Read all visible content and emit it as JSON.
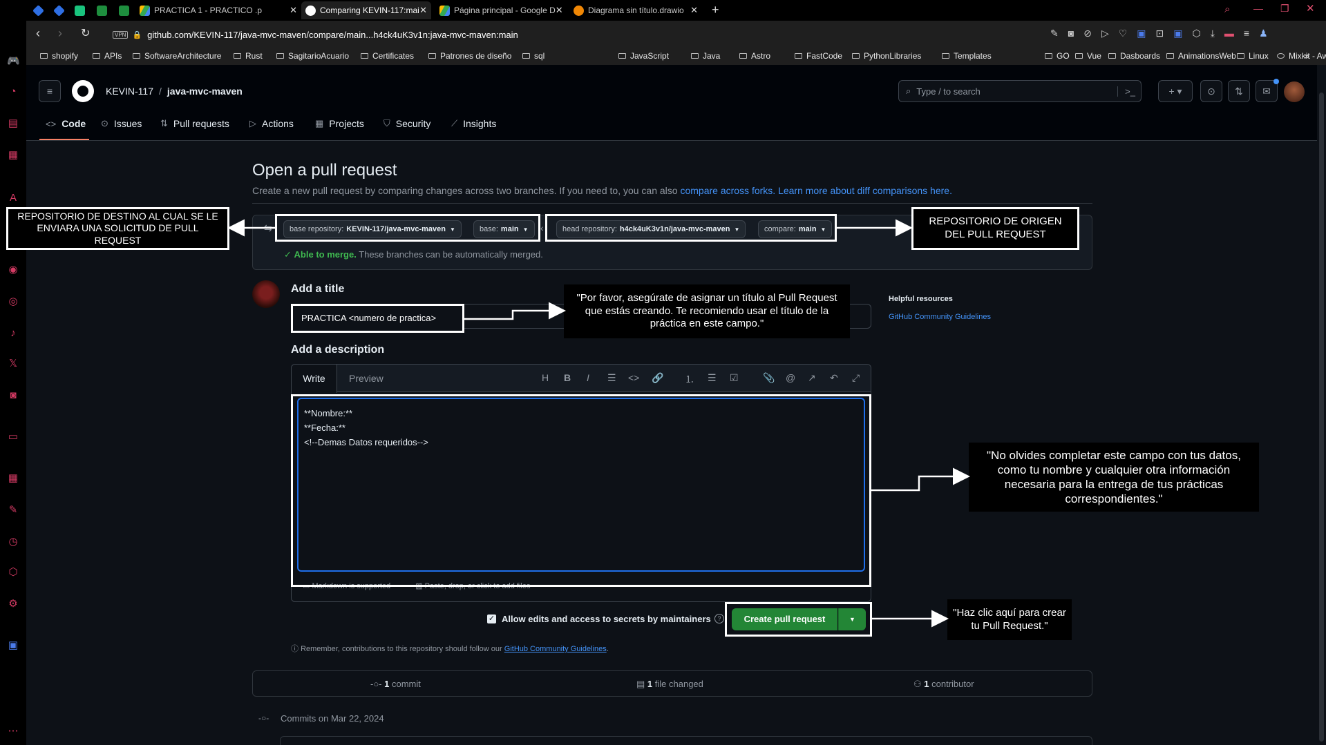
{
  "browser": {
    "tabs": [
      {
        "label": "",
        "icon": "extension-icon"
      },
      {
        "label": "",
        "icon": "extension-icon"
      },
      {
        "label": "",
        "icon": "chatgpt-icon"
      },
      {
        "label": "",
        "icon": "sheets-icon"
      },
      {
        "label": "",
        "icon": "sheets-icon"
      },
      {
        "label": "PRACTICA 1 - PRACTICO .p",
        "icon": "drive-icon"
      },
      {
        "label": "Comparing KEVIN-117:mai",
        "icon": "github-icon"
      },
      {
        "label": "Página principal - Google D",
        "icon": "drive-icon"
      },
      {
        "label": "Diagrama sin título.drawio",
        "icon": "drawio-icon"
      }
    ],
    "vpn_label": "VPN",
    "url": "github.com/KEVIN-117/java-mvc-maven/compare/main...h4ck4uK3v1n:java-mvc-maven:main",
    "bookmarks": [
      "shopify",
      "APIs",
      "SoftwareArchitecture",
      "Rust",
      "SagitarioAcuario",
      "Certificates",
      "Patrones de diseño",
      "sql",
      "JavaScript",
      "Java",
      "Astro",
      "FastCode",
      "PythonLibraries",
      "Templates",
      "GO",
      "Vue",
      "Dasboards",
      "AnimationsWeb",
      "Linux",
      "Mixkit - Awesome f..."
    ]
  },
  "github": {
    "owner": "KEVIN-117",
    "separator": "/",
    "repo": "java-mvc-maven",
    "search_placeholder": "Type / to search",
    "nav": [
      "Code",
      "Issues",
      "Pull requests",
      "Actions",
      "Projects",
      "Security",
      "Insights"
    ],
    "page_title": "Open a pull request",
    "subtitle_text": "Create a new pull request by comparing changes across two branches. If you need to, you can also",
    "subtitle_link1": "compare across forks.",
    "subtitle_link2": "Learn more about diff comparisons here.",
    "base_repo_label": "base repository:",
    "base_repo_value": "KEVIN-117/java-mvc-maven",
    "base_label": "base:",
    "base_value": "main",
    "head_repo_label": "head repository:",
    "head_repo_value": "h4ck4uK3v1n/java-mvc-maven",
    "compare_label": "compare:",
    "compare_value": "main",
    "merge_status": "Able to merge.",
    "merge_detail": "These branches can be automatically merged.",
    "add_title_heading": "Add a title",
    "title_value": "PRACTICA <numero de practica>",
    "add_description_heading": "Add a description",
    "editor_tabs": [
      "Write",
      "Preview"
    ],
    "description_lines": [
      "**Nombre:**",
      "**Fecha:**",
      "<!--Demas Datos requeridos-->"
    ],
    "markdown_note": "Markdown is supported",
    "paste_note": "Paste, drop, or click to add files",
    "allow_edits_label": "Allow edits and access to secrets by maintainers",
    "create_button": "Create pull request",
    "remember_text": "Remember, contributions to this repository should follow our",
    "remember_link": "GitHub Community Guidelines",
    "remember_end": ".",
    "helpful_heading": "Helpful resources",
    "helpful_link": "GitHub Community Guidelines",
    "summary": [
      {
        "count": "1",
        "label": "commit"
      },
      {
        "count": "1",
        "label": "file changed"
      },
      {
        "count": "1",
        "label": "contributor"
      }
    ],
    "commits_heading": "Commits on Mar 22, 2024"
  },
  "annotations": {
    "destino": "REPOSITORIO DE DESTINO AL CUAL SE LE ENVIARA UNA SOLICITUD DE PULL REQUEST",
    "origen": "REPOSITORIO DE ORIGEN DEL PULL REQUEST",
    "titulo": "\"Por favor, asegúrate de asignar un título al Pull Request que estás creando. Te recomiendo usar el título de la práctica en este campo.\"",
    "descripcion": "\"No olvides completar este campo con tus datos, como tu nombre y cualquier otra información necesaria para la entrega de tus prácticas correspondientes.\"",
    "crear": "\"Haz clic aquí para crear tu Pull Request.\""
  },
  "colors": {
    "accent_green": "#238636",
    "link_blue": "#4493f8",
    "tab_underline": "#f78166",
    "sidebar_icon": "#d33a63"
  }
}
